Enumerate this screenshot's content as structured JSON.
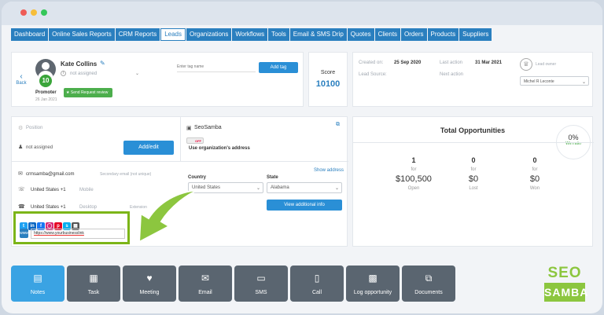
{
  "nav": {
    "tabs": [
      "Dashboard",
      "Online Sales Reports",
      "CRM Reports",
      "Leads",
      "Organizations",
      "Workflows",
      "Tools",
      "Email & SMS Drip",
      "Quotes",
      "Clients",
      "Orders",
      "Products",
      "Suppliers"
    ],
    "active": "Leads"
  },
  "profile": {
    "back_label": "Back",
    "name": "Kate Collins",
    "status_value": "not assigned",
    "badge_number": "10",
    "role": "Promoter",
    "date": "26 Jan 2021",
    "review_button": "Send Request review",
    "tag_placeholder": "Enter tag name",
    "add_tag_button": "Add tag"
  },
  "score": {
    "label": "Score",
    "value": "10100"
  },
  "meta": {
    "created_on_label": "Created on:",
    "created_on": "25 Sep 2020",
    "last_action_label": "Last action",
    "last_action": "31 Mar 2021",
    "lead_source_label": "Lead Source:",
    "next_action_label": "Next action",
    "lead_owner_label": "Lead owner",
    "lead_owner": "Michel R Leconte"
  },
  "details": {
    "position_label": "Position",
    "assigned_value": "not assigned",
    "add_edit_button": "Add/edit",
    "org_name": "SeoSamba",
    "toggle_label": "OFF",
    "use_org_address": "Use organization's address",
    "email": "crmsamba@gmail.com",
    "secondary_email_placeholder": "Secondary email (not unique)",
    "phone_country": "United States +1",
    "mobile_label": "Mobile",
    "desktop_country": "United States +1",
    "desktop_label": "Desktop",
    "extension_label": "Extension",
    "show_address": "Show address",
    "country_label": "Country",
    "country_value": "United States",
    "state_label": "State",
    "state_value": "Alabama",
    "view_info_button": "View additional info",
    "website": "https://www.yourbusinesslink"
  },
  "opportunities": {
    "title": "Total Opportunities",
    "ratio": "0%",
    "ratio_label": "Win ratio",
    "cols": [
      {
        "count": "1",
        "for": "for",
        "amount": "$100,500",
        "label": "Open"
      },
      {
        "count": "0",
        "for": "for",
        "amount": "$0",
        "label": "Lost"
      },
      {
        "count": "0",
        "for": "for",
        "amount": "$0",
        "label": "Won"
      }
    ]
  },
  "actions": [
    "Notes",
    "Task",
    "Meeting",
    "Email",
    "SMS",
    "Call",
    "Log opportunity",
    "Documents"
  ],
  "logo": {
    "top": "SEO",
    "bottom": "SAMBA"
  },
  "colors": {
    "primary": "#2a7fbf",
    "highlight": "#7cb518",
    "accent_green": "#8cc63f",
    "action_bg": "#5a6570"
  }
}
